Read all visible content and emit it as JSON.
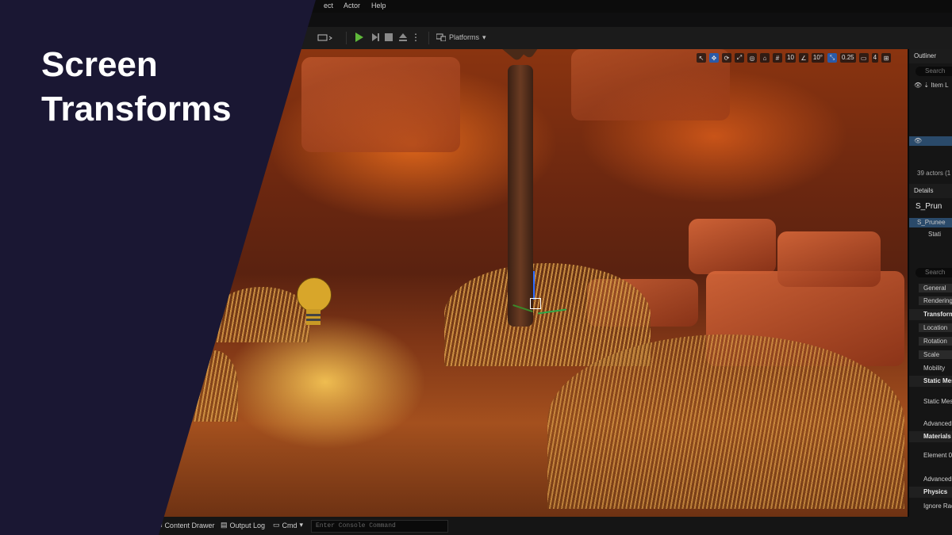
{
  "title": {
    "line1": "Screen",
    "line2": "Transforms"
  },
  "menu": {
    "items": [
      "ect",
      "Actor",
      "Help"
    ]
  },
  "toolbar": {
    "platforms_label": "Platforms",
    "more_icon": "⋮"
  },
  "viewport_toolbar": {
    "grid_snap": "10",
    "rotation_snap": "10°",
    "scale_snap": "0.25",
    "camera_speed": "4"
  },
  "outliner": {
    "header": "Outliner",
    "search_placeholder": "Search",
    "column_label": "Item L",
    "actor_count": "39 actors (1"
  },
  "details": {
    "header": "Details",
    "actor_name": "S_Prun",
    "component_root": "S_Prunee",
    "component_child": "Stati",
    "search_placeholder": "Search",
    "tabs": [
      "General",
      "Rendering"
    ],
    "sections": {
      "transform": "Transform",
      "static_mesh": "Static Mesh",
      "materials": "Materials",
      "physics": "Physics"
    },
    "transform_props": [
      "Location",
      "Rotation",
      "Scale"
    ],
    "mobility": "Mobility",
    "static_mesh_prop": "Static Mesh",
    "advanced_1": "Advanced",
    "element_0": "Element 0",
    "advanced_2": "Advanced",
    "ignore_radial": "Ignore Radia"
  },
  "statusbar": {
    "content_drawer": "Content Drawer",
    "output_log": "Output Log",
    "cmd": "Cmd",
    "console_placeholder": "Enter Console Command"
  },
  "colors": {
    "overlay": "#1a1733",
    "play_green": "#5fb83a",
    "selection_blue": "#2b5aa8"
  }
}
